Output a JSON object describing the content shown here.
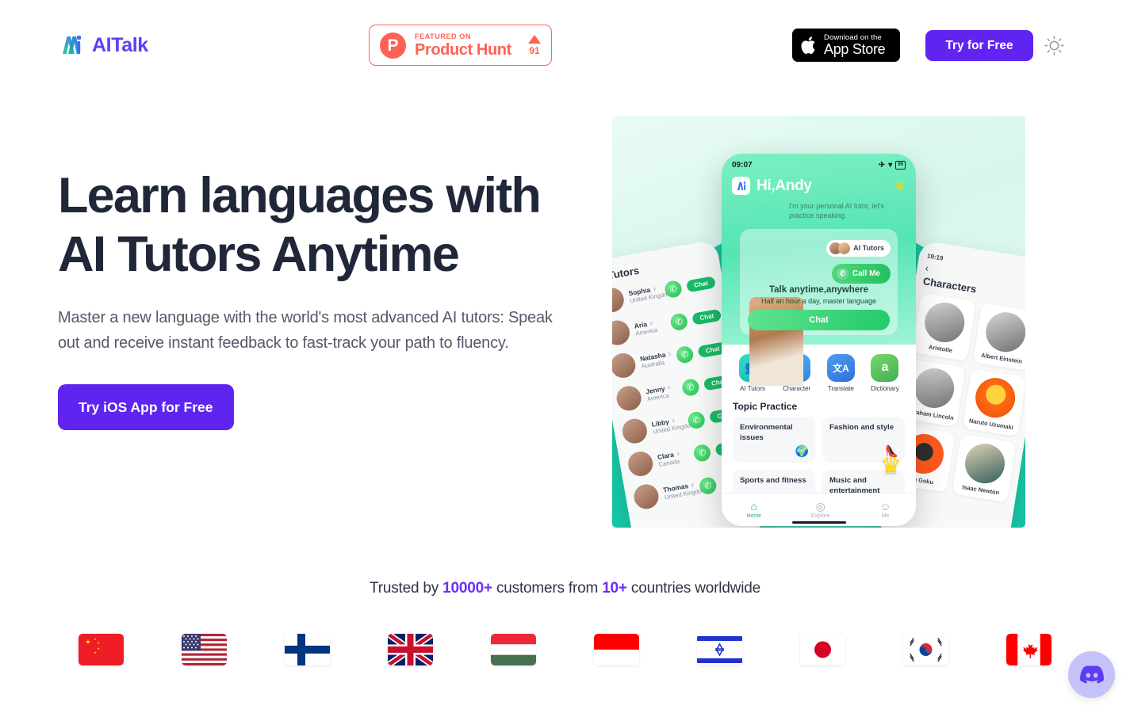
{
  "header": {
    "brand_name": "AITalk",
    "brand_icon": "aitalk-logo-icon",
    "product_hunt": {
      "featured_label": "FEATURED ON",
      "name": "Product Hunt",
      "upvotes": "91",
      "logo_letter": "P",
      "accent_color": "#ff6154"
    },
    "app_store": {
      "small_label": "Download on the",
      "big_label": "App Store",
      "icon": "apple-icon"
    },
    "try_free_label": "Try for Free",
    "theme_toggle_icon": "sun-icon"
  },
  "hero": {
    "title": "Learn languages with AI Tutors Anytime",
    "subtitle": "Master a new language with the world's most advanced AI tutors: Speak out and receive instant feedback to fast-track your path to fluency.",
    "cta_label": "Try iOS App for Free",
    "accent_color": "#5f24f0"
  },
  "phone_main": {
    "status_time": "09:07",
    "status_battery": "95",
    "greeting": "Hi,Andy",
    "tutor_message": "I'm your personal AI tutor, let's practice speaking.",
    "ai_tutors_pill": "AI Tutors",
    "call_button": "Call Me",
    "talk_title": "Talk anytime,anywhere",
    "talk_subtitle": "Half an hour a day, master language",
    "chat_button": "Chat",
    "features": [
      {
        "label": "AI Tutors",
        "glyph": "👥"
      },
      {
        "label": "Character",
        "glyph": "AI"
      },
      {
        "label": "Translate",
        "glyph": "文A"
      },
      {
        "label": "Dictionary",
        "glyph": "a"
      }
    ],
    "topic_head": "Topic Practice",
    "topics": [
      {
        "label": "Environmental issues",
        "emoji": "🌍"
      },
      {
        "label": "Fashion and style",
        "emoji": "👠"
      },
      {
        "label": "Sports and fitness",
        "emoji": ""
      },
      {
        "label": "Music and entertainment",
        "emoji": ""
      }
    ],
    "nav": [
      {
        "label": "Home",
        "glyph": "⌂"
      },
      {
        "label": "Explore",
        "glyph": "◎"
      },
      {
        "label": "Me",
        "glyph": "☺"
      }
    ]
  },
  "phone_left": {
    "title": "AI Tutors",
    "chat_label": "Chat",
    "tutors": [
      {
        "name": "Sophia",
        "gender": "female",
        "location": "United Kingdom"
      },
      {
        "name": "Aria",
        "gender": "female",
        "location": "America"
      },
      {
        "name": "Natasha",
        "gender": "female",
        "location": "Australia"
      },
      {
        "name": "Jenny",
        "gender": "female",
        "location": "America"
      },
      {
        "name": "Libby",
        "gender": "female",
        "location": "United Kingdom"
      },
      {
        "name": "Clara",
        "gender": "female",
        "location": "Canada"
      },
      {
        "name": "Thomas",
        "gender": "male",
        "location": "United Kingdom"
      }
    ]
  },
  "phone_right": {
    "status_time": "19:19",
    "title": "Characters",
    "back_icon": "chevron-left-icon",
    "characters": [
      {
        "name": "Aristotle",
        "style": ""
      },
      {
        "name": "Albert Einstein",
        "style": ""
      },
      {
        "name": "Abraham Lincoln",
        "style": ""
      },
      {
        "name": "Naruto Uzumaki",
        "style": "c-naruto"
      },
      {
        "name": "Son Goku",
        "style": "c-goku"
      },
      {
        "name": "Isaac Newton",
        "style": "c-newton"
      }
    ]
  },
  "trust": {
    "prefix": "Trusted by ",
    "customers": "10000+",
    "middle": " customers from ",
    "countries": "10+",
    "suffix": " countries worldwide",
    "flags": [
      {
        "country": "China",
        "code": "cn"
      },
      {
        "country": "United States",
        "code": "us"
      },
      {
        "country": "Finland",
        "code": "fi"
      },
      {
        "country": "United Kingdom",
        "code": "gb"
      },
      {
        "country": "Hungary",
        "code": "hu"
      },
      {
        "country": "Indonesia",
        "code": "id"
      },
      {
        "country": "Israel",
        "code": "il"
      },
      {
        "country": "Japan",
        "code": "jp"
      },
      {
        "country": "South Korea",
        "code": "kr"
      },
      {
        "country": "Canada",
        "code": "ca"
      }
    ]
  },
  "discord": {
    "icon": "discord-icon",
    "label": "Discord"
  }
}
